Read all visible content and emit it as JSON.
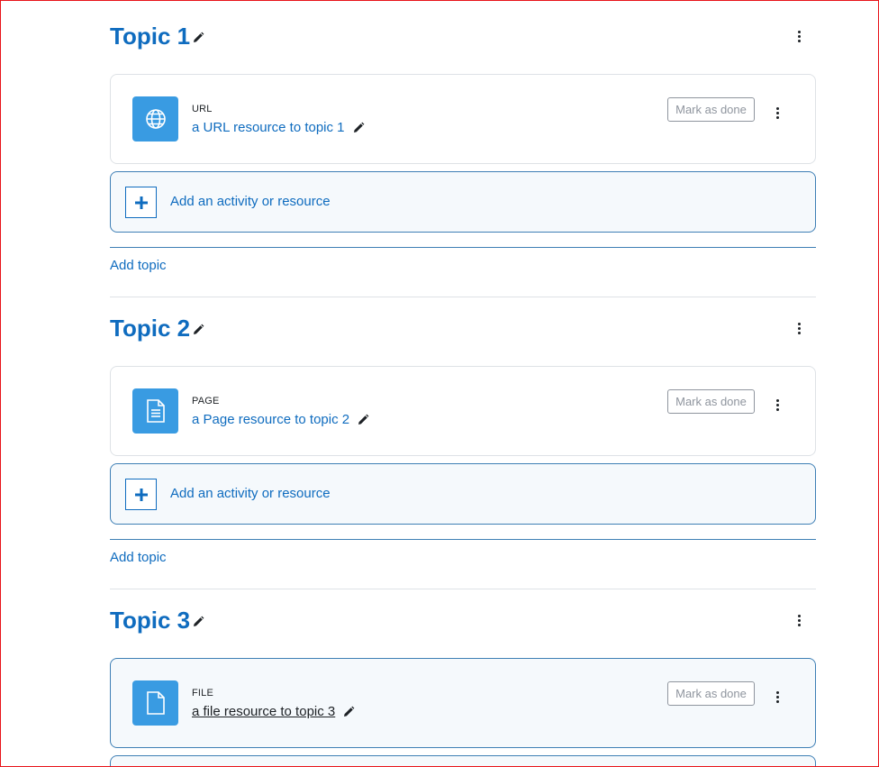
{
  "sections": [
    {
      "title": "Topic 1",
      "activity": {
        "type": "URL",
        "name": "a URL resource to topic 1",
        "icon": "globe-icon",
        "mark_done": "Mark as done"
      },
      "add_activity": "Add an activity or resource",
      "add_topic": "Add topic"
    },
    {
      "title": "Topic 2",
      "activity": {
        "type": "PAGE",
        "name": "a Page resource to topic 2",
        "icon": "page-icon",
        "mark_done": "Mark as done"
      },
      "add_activity": "Add an activity or resource",
      "add_topic": "Add topic"
    },
    {
      "title": "Topic 3",
      "activity": {
        "type": "FILE",
        "name": "a file resource to topic 3",
        "icon": "file-icon",
        "mark_done": "Mark as done"
      }
    }
  ],
  "colors": {
    "accent": "#0f6cbf",
    "activity_icon_bg": "#399be2",
    "highlight_bg": "#f5f9fc",
    "frame": "#e8141a"
  }
}
